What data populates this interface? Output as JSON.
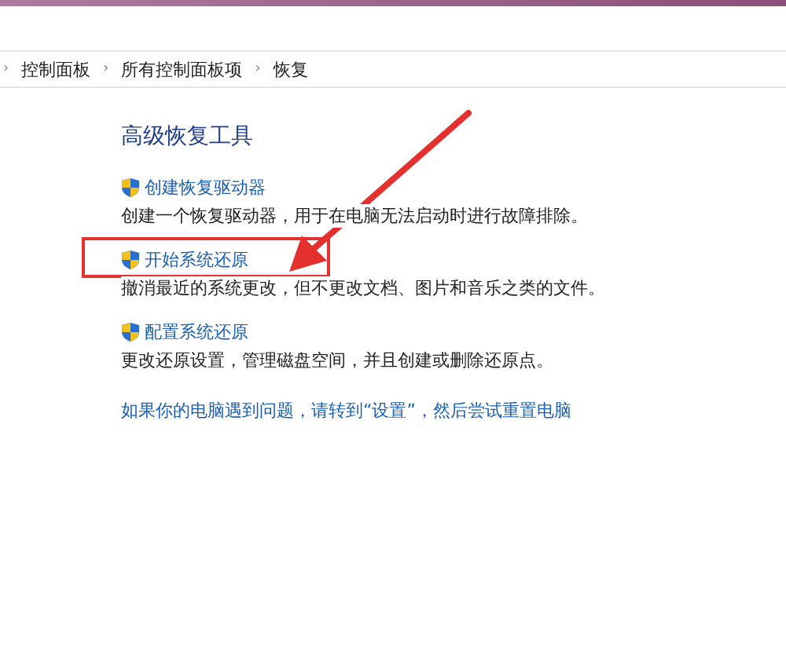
{
  "breadcrumb": [
    {
      "separator": "›",
      "label": "控制面板"
    },
    {
      "separator": "›",
      "label": "所有控制面板项"
    },
    {
      "separator": "›",
      "label": "恢复"
    }
  ],
  "title": "高级恢复工具",
  "tools": [
    {
      "link": "创建恢复驱动器",
      "description": "创建一个恢复驱动器，用于在电脑无法启动时进行故障排除。",
      "highlighted": false
    },
    {
      "link": "开始系统还原",
      "description": "撤消最近的系统更改，但不更改文档、图片和音乐之类的文件。",
      "highlighted": true
    },
    {
      "link": "配置系统还原",
      "description": "更改还原设置，管理磁盘空间，并且创建或删除还原点。",
      "highlighted": false
    }
  ],
  "footer_link": "如果你的电脑遇到问题，请转到“设置”，然后尝试重置电脑"
}
